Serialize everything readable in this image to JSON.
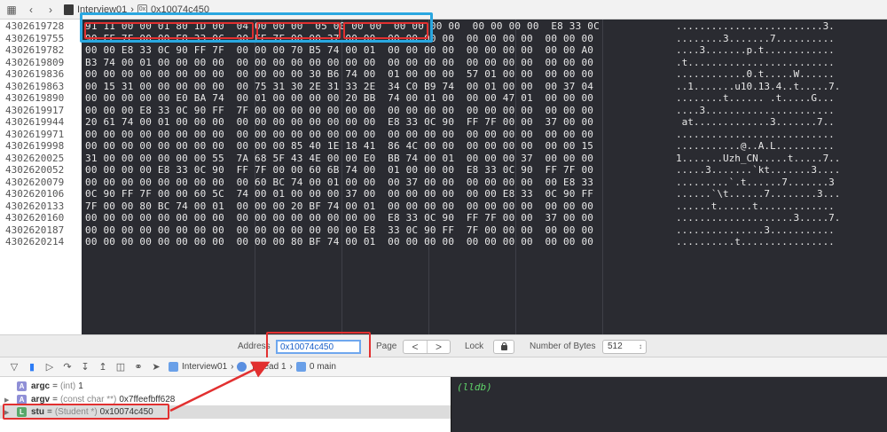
{
  "toolbar": {
    "breadcrumb": [
      "Interview01",
      "0x10074c450"
    ]
  },
  "memory": {
    "addresses": [
      "4302619728",
      "4302619755",
      "4302619782",
      "4302619809",
      "4302619836",
      "4302619863",
      "4302619890",
      "4302619917",
      "4302619944",
      "4302619971",
      "4302619998",
      "4302620025",
      "4302620052",
      "4302620079",
      "4302620106",
      "4302620133",
      "4302620160",
      "4302620187",
      "4302620214"
    ],
    "hex_rows": [
      "91 11 00 00 01 80 1D 00  04 00 00 00  05 00 00 00  00 00 00 00  00 00 00 00  E8 33 0C",
      "90 FF 7F 00 00 E8 33 0C  90 FF 7F 00 00 37 00 00  00 00 00 00  00 00 00 00  00 00 00",
      "00 00 E8 33 0C 90 FF 7F  00 00 00 70 B5 74 00 01  00 00 00 00  00 00 00 00  00 00 A0",
      "B3 74 00 01 00 00 00 00  00 00 00 00 00 00 00 00  00 00 00 00  00 00 00 00  00 00 00",
      "00 00 00 00 00 00 00 00  00 00 00 00 30 B6 74 00  01 00 00 00  57 01 00 00  00 00 00",
      "00 15 31 00 00 00 00 00  00 75 31 30 2E 31 33 2E  34 C0 B9 74  00 01 00 00  00 37 04",
      "00 00 00 00 00 E0 BA 74  00 01 00 00 00 00 20 BB  74 00 01 00  00 00 47 01  00 00 00",
      "00 00 00 E8 33 0C 90 FF  7F 00 00 00 00 00 00 00  00 00 00 00  00 00 00 00  00 00 00",
      "20 61 74 00 01 00 00 00  00 00 00 00 00 00 00 00  E8 33 0C 90  FF 7F 00 00  37 00 00",
      "00 00 00 00 00 00 00 00  00 00 00 00 00 00 00 00  00 00 00 00  00 00 00 00  00 00 00",
      "00 00 00 00 00 00 00 00  00 00 00 85 40 1E 18 41  86 4C 00 00  00 00 00 00  00 00 15",
      "31 00 00 00 00 00 00 55  7A 68 5F 43 4E 00 00 E0  BB 74 00 01  00 00 00 37  00 00 00",
      "00 00 00 00 E8 33 0C 90  FF 7F 00 00 60 6B 74 00  01 00 00 00  E8 33 0C 90  FF 7F 00",
      "00 00 00 00 00 00 00 00  00 60 BC 74 00 01 00 00  00 37 00 00  00 00 00 00  00 E8 33",
      "0C 90 FF 7F 00 00 60 5C  74 00 01 00 00 00 37 00  00 00 00 00  00 00 E8 33  0C 90 FF",
      "7F 00 00 80 BC 74 00 01  00 00 00 20 BF 74 00 01  00 00 00 00  00 00 00 00  00 00 00",
      "00 00 00 00 00 00 00 00  00 00 00 00 00 00 00 00  E8 33 0C 90  FF 7F 00 00  37 00 00",
      "00 00 00 00 00 00 00 00  00 00 00 00 00 00 00 E8  33 0C 90 FF  7F 00 00 00  00 00 00",
      "00 00 00 00 00 00 00 00  00 00 00 80 BF 74 00 01  00 00 00 00  00 00 00 00  00 00 00"
    ],
    "ascii_rows": [
      ".........................3.",
      "........3.......7..........",
      "....3.......p.t............",
      ".t.........................",
      "............0.t.....W......",
      "..1.......u10.13.4..t.....7.",
      "........t...... .t.....G...",
      "....3......................",
      " at.............3.......7..",
      "...........................",
      "...........@..A.L..........",
      "1.......Uzh_CN.....t.....7..",
      ".....3.......`kt.......3....",
      ".........`.t......7.......3",
      "......`\\t......7........3...",
      "......t......t.............",
      "....................3.....7.",
      "...............3...........",
      "..........t................"
    ]
  },
  "address_bar": {
    "address_label": "Address",
    "address_value": "0x10074c450",
    "page_label": "Page",
    "prev_symbol": "<",
    "next_symbol": ">",
    "lock_label": "Lock",
    "bytes_label": "Number of Bytes",
    "bytes_value": "512"
  },
  "debug_bar": {
    "process": "Interview01",
    "thread": "Thread 1",
    "frame": "0 main"
  },
  "variables": [
    {
      "badge": "A",
      "name": "argc",
      "type": "(int)",
      "value": "1",
      "selected": false
    },
    {
      "badge": "A",
      "name": "argv",
      "type": "(const char **)",
      "value": "0x7ffeefbff628",
      "selected": false
    },
    {
      "badge": "L",
      "name": "stu",
      "type": "(Student *)",
      "value": "0x10074c450",
      "selected": true
    }
  ],
  "console": {
    "prompt": "(lldb)"
  },
  "colors": {
    "memory_bg": "#2a2b31",
    "highlight_red": "#e23030",
    "highlight_blue": "#2aa7e0",
    "console_prompt": "#5fd46a"
  }
}
